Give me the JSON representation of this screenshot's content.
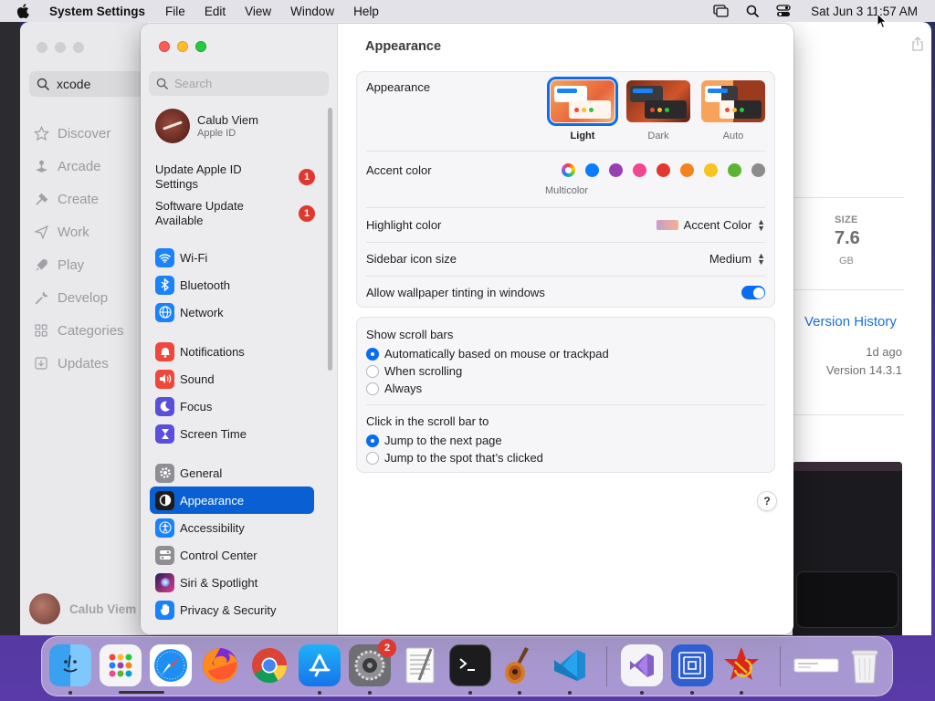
{
  "menubar": {
    "app_name": "System Settings",
    "menus": [
      "File",
      "Edit",
      "View",
      "Window",
      "Help"
    ],
    "clock": "Sat Jun 3  11:57 AM"
  },
  "appstore": {
    "search_value": "xcode",
    "nav": [
      {
        "label": "Discover",
        "icon": "star-icon"
      },
      {
        "label": "Arcade",
        "icon": "joystick-icon"
      },
      {
        "label": "Create",
        "icon": "hammer-icon"
      },
      {
        "label": "Work",
        "icon": "paperplane-icon"
      },
      {
        "label": "Play",
        "icon": "rocket-icon"
      },
      {
        "label": "Develop",
        "icon": "wrench-icon"
      },
      {
        "label": "Categories",
        "icon": "grid-icon"
      },
      {
        "label": "Updates",
        "icon": "download-icon"
      }
    ],
    "user_name": "Calub Viem",
    "size_label": "SIZE",
    "size_value": "7.6",
    "size_unit": "GB",
    "version_history": "Version History",
    "updated_ago": "1d ago",
    "version": "Version 14.3.1"
  },
  "settings": {
    "search_placeholder": "Search",
    "profile": {
      "name": "Calub Viem",
      "subtitle": "Apple ID"
    },
    "updates": [
      {
        "label": "Update Apple ID Settings",
        "badge": "1"
      },
      {
        "label": "Software Update Available",
        "badge": "1"
      }
    ],
    "sidebar": [
      {
        "label": "Wi-Fi",
        "icon": "wifi-icon",
        "color": "#1a82fb"
      },
      {
        "label": "Bluetooth",
        "icon": "bluetooth-icon",
        "color": "#1a82fb"
      },
      {
        "label": "Network",
        "icon": "globe-icon",
        "color": "#1a82fb"
      },
      {
        "label": "Notifications",
        "icon": "bell-icon",
        "color": "#f0473d"
      },
      {
        "label": "Sound",
        "icon": "speaker-icon",
        "color": "#f0473d"
      },
      {
        "label": "Focus",
        "icon": "moon-icon",
        "color": "#5a4fd8"
      },
      {
        "label": "Screen Time",
        "icon": "hourglass-icon",
        "color": "#5a4fd8"
      },
      {
        "label": "General",
        "icon": "gear-icon",
        "color": "#8e8e93"
      },
      {
        "label": "Appearance",
        "icon": "appearance-icon",
        "color": "#1c1c1e",
        "selected": true
      },
      {
        "label": "Accessibility",
        "icon": "accessibility-icon",
        "color": "#1a82fb"
      },
      {
        "label": "Control Center",
        "icon": "switches-icon",
        "color": "#8e8e93"
      },
      {
        "label": "Siri & Spotlight",
        "icon": "siri-icon",
        "color": "#7a3fe0"
      },
      {
        "label": "Privacy & Security",
        "icon": "hand-icon",
        "color": "#1a82fb"
      }
    ],
    "title": "Appearance",
    "appearance_label": "Appearance",
    "themes": [
      {
        "label": "Light",
        "selected": true
      },
      {
        "label": "Dark",
        "selected": false
      },
      {
        "label": "Auto",
        "selected": false
      }
    ],
    "accent_label": "Accent color",
    "accent_colors": [
      "multicolor",
      "#0a7cff",
      "#9a3fb2",
      "#f2468f",
      "#e2372f",
      "#f3831d",
      "#f8c31c",
      "#5cb531",
      "#8c8c8c"
    ],
    "accent_selected_name": "Multicolor",
    "highlight_label": "Highlight color",
    "highlight_value": "Accent Color",
    "sidebar_icon_label": "Sidebar icon size",
    "sidebar_icon_value": "Medium",
    "tinting_label": "Allow wallpaper tinting in windows",
    "tinting_on": true,
    "scrollbars_label": "Show scroll bars",
    "scrollbar_options": [
      {
        "label": "Automatically based on mouse or trackpad",
        "selected": true
      },
      {
        "label": "When scrolling",
        "selected": false
      },
      {
        "label": "Always",
        "selected": false
      }
    ],
    "click_label": "Click in the scroll bar to",
    "click_options": [
      {
        "label": "Jump to the next page",
        "selected": true
      },
      {
        "label": "Jump to the spot that’s clicked",
        "selected": false
      }
    ],
    "help_label": "?"
  },
  "dock": {
    "apps": [
      {
        "name": "Finder",
        "icon": "finder-icon",
        "running": true
      },
      {
        "name": "Launchpad",
        "icon": "launchpad-icon",
        "running": true
      },
      {
        "name": "Safari",
        "icon": "safari-icon",
        "running": false
      },
      {
        "name": "Firefox",
        "icon": "firefox-icon",
        "running": false
      },
      {
        "name": "Chrome",
        "icon": "chrome-icon",
        "running": false
      },
      {
        "name": "App Store",
        "icon": "appstore-icon",
        "running": true
      },
      {
        "name": "System Settings",
        "icon": "settings-icon",
        "running": true,
        "badge": "2"
      },
      {
        "name": "TextEdit",
        "icon": "textedit-icon",
        "running": false
      },
      {
        "name": "Terminal",
        "icon": "terminal-icon",
        "running": true
      },
      {
        "name": "GarageBand",
        "icon": "garageband-icon",
        "running": true
      },
      {
        "name": "VS Code",
        "icon": "vscode-icon",
        "running": true
      },
      {
        "name": "Visual Studio",
        "icon": "visualstudio-icon",
        "running": true
      },
      {
        "name": "Archive",
        "icon": "archive-icon",
        "running": true
      },
      {
        "name": "Hammer Sickle",
        "icon": "hammer-sickle-icon",
        "running": true
      },
      {
        "name": "Window Preview",
        "icon": "window-preview-icon",
        "running": false
      },
      {
        "name": "Trash",
        "icon": "trash-icon",
        "running": false
      }
    ]
  }
}
